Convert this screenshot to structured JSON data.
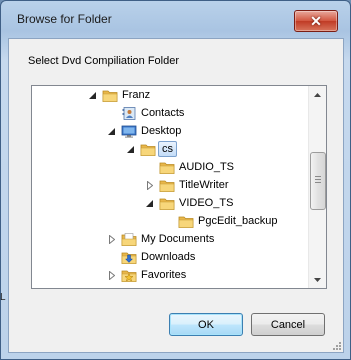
{
  "window": {
    "title": "Browse for Folder",
    "close_glyph": "✕"
  },
  "prompt": "Select Dvd Compiliation Folder",
  "tree": {
    "rows": [
      {
        "label": "Franz",
        "icon": "folder-icon",
        "toggle": "expanded",
        "level": 0
      },
      {
        "label": "Contacts",
        "icon": "contacts-icon",
        "toggle": "none",
        "level": 1
      },
      {
        "label": "Desktop",
        "icon": "desktop-icon",
        "toggle": "expanded",
        "level": 1
      },
      {
        "label": "cs",
        "icon": "folder-icon",
        "toggle": "expanded",
        "level": 2,
        "selected": true
      },
      {
        "label": "AUDIO_TS",
        "icon": "folder-icon",
        "toggle": "none",
        "level": 3
      },
      {
        "label": "TitleWriter",
        "icon": "folder-icon",
        "toggle": "collapsed",
        "level": 3
      },
      {
        "label": "VIDEO_TS",
        "icon": "folder-icon",
        "toggle": "expanded",
        "level": 3
      },
      {
        "label": "PgcEdit_backup",
        "icon": "folder-icon",
        "toggle": "none",
        "level": 4
      },
      {
        "label": "My Documents",
        "icon": "documents-icon",
        "toggle": "collapsed",
        "level": 1
      },
      {
        "label": "Downloads",
        "icon": "downloads-icon",
        "toggle": "none",
        "level": 1
      },
      {
        "label": "Favorites",
        "icon": "favorites-icon",
        "toggle": "collapsed",
        "level": 1
      }
    ]
  },
  "buttons": {
    "ok": "OK",
    "cancel": "Cancel"
  },
  "background_fragment": "L"
}
